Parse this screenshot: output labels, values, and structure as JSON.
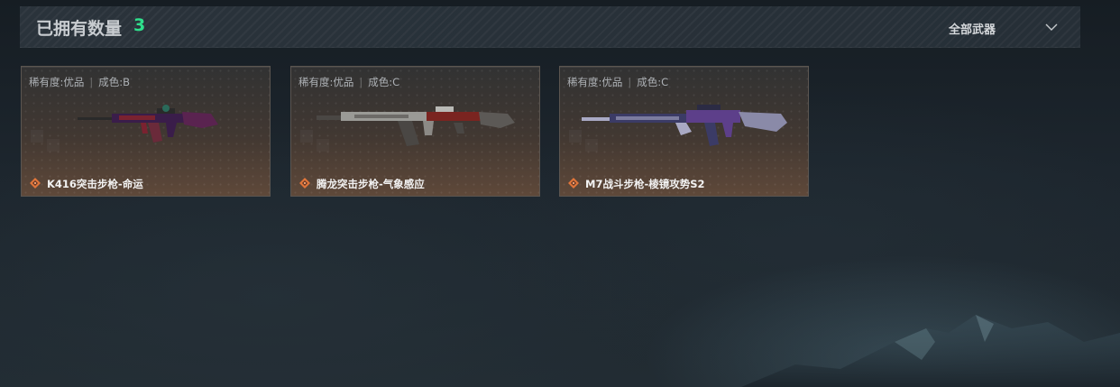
{
  "header": {
    "owned_label": "已拥有数量",
    "owned_count": "3",
    "filter": {
      "selected": "全部武器",
      "icon": "chevron-down-icon"
    }
  },
  "colors": {
    "count_accent": "#2fe08c",
    "rarity_icon": "#e0753a",
    "card_border": "#5b5550"
  },
  "cards": [
    {
      "rarity_label": "稀有度:优品",
      "wear_label": "成色:B",
      "name": "K416突击步枪-命运",
      "icon": "rarity-diamond-icon",
      "skin_colors": [
        "#3a1d4a",
        "#7a2230",
        "#2a6a5a"
      ]
    },
    {
      "rarity_label": "稀有度:优品",
      "wear_label": "成色:C",
      "name": "腾龙突击步枪-气象感应",
      "icon": "rarity-diamond-icon",
      "skin_colors": [
        "#9a9a96",
        "#4a4744",
        "#7a2420"
      ]
    },
    {
      "rarity_label": "稀有度:优品",
      "wear_label": "成色:C",
      "name": "M7战斗步枪-棱镜攻势S2",
      "icon": "rarity-diamond-icon",
      "skin_colors": [
        "#3b3b66",
        "#a9a9c4",
        "#5d3f8a"
      ]
    }
  ]
}
